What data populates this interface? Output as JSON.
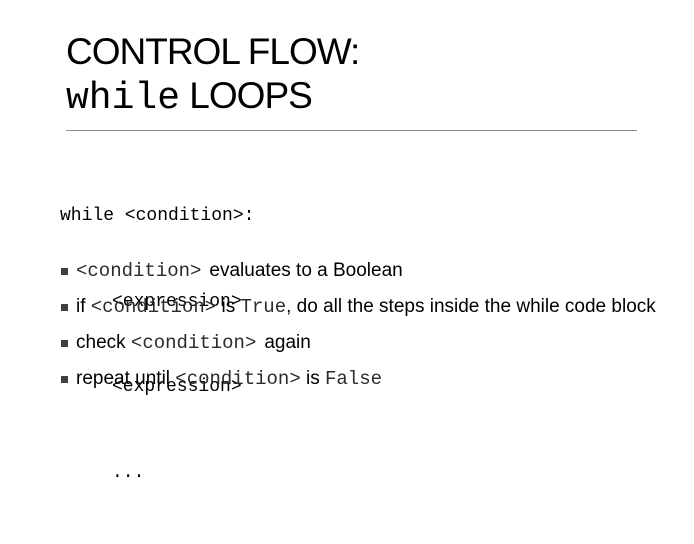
{
  "slide": {
    "title_line1": "CONTROL FLOW:",
    "title_keyword": "while",
    "title_suffix": " LOOPS",
    "code": {
      "line1": "while <condition>:",
      "line2": "<expression>",
      "line3": "<expression>",
      "line4": "..."
    },
    "bullets": {
      "b1": {
        "code1": "<condition>",
        "text1": "evaluates to a Boolean"
      },
      "b2": {
        "text1": "if ",
        "code1": "<condition>",
        "text2": " is ",
        "code2": "True",
        "text3": ", do all the steps inside the while code block"
      },
      "b3": {
        "text1": "check ",
        "code1": "<condition>",
        "text2": "again"
      },
      "b4": {
        "text1": "repeat until ",
        "code1": "<condition>",
        "text2": " is ",
        "code2": "False"
      }
    }
  }
}
